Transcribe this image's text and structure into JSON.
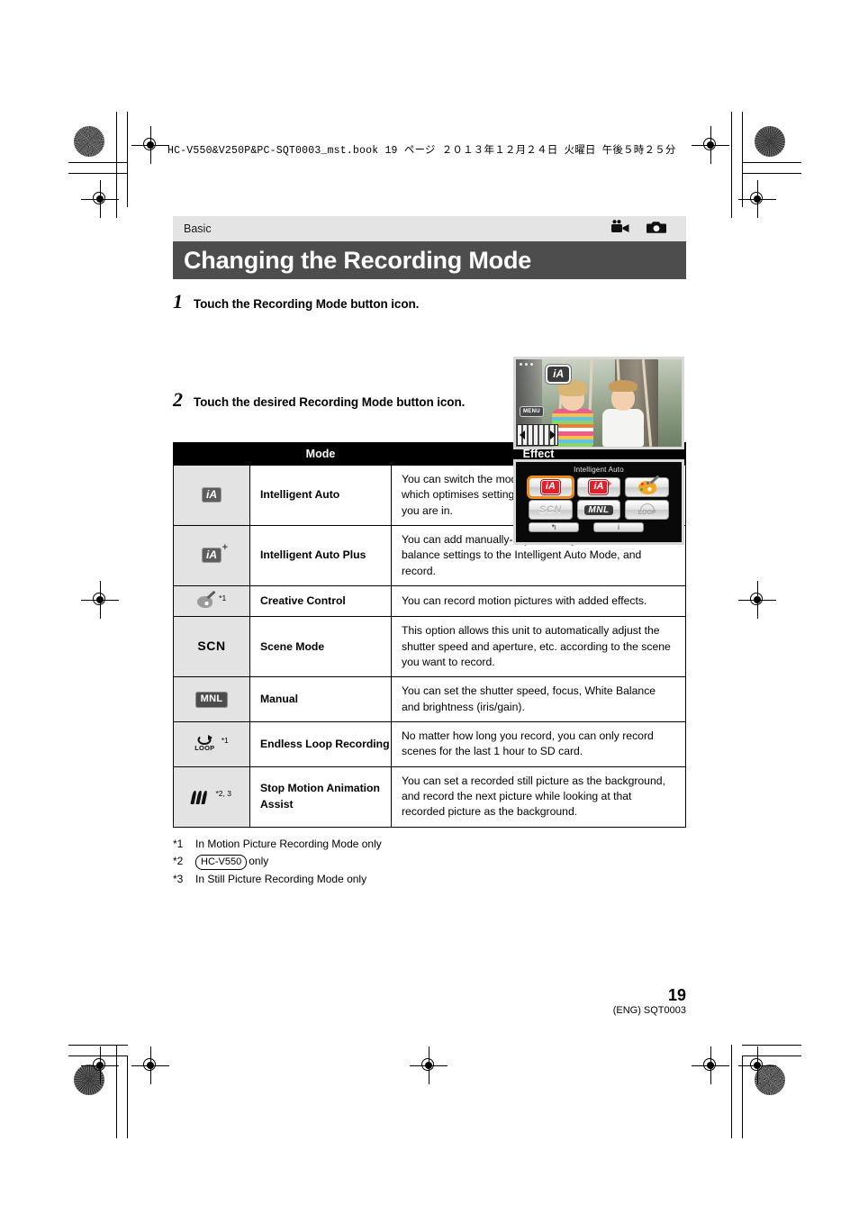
{
  "slug": "HC-V550&V250P&PC-SQT0003_mst.book   19 ページ   ２０１３年１２月２４日   火曜日   午後５時２５分",
  "header": {
    "section_label": "Basic",
    "title": "Changing the Recording Mode",
    "icons": [
      "video-camera-icon",
      "still-camera-icon"
    ]
  },
  "steps": [
    {
      "num": "1",
      "text": "Touch the Recording Mode button icon."
    },
    {
      "num": "2",
      "text": "Touch the desired Recording Mode button icon."
    }
  ],
  "screenshot1": {
    "name": "lcd-preview-screen",
    "badge": "iA",
    "menu_button": "MENU"
  },
  "screenshot2": {
    "name": "recording-mode-menu-screen",
    "title": "Intelligent Auto",
    "buttons": [
      {
        "icon": "ia-icon",
        "label": "iA",
        "selected": true
      },
      {
        "icon": "ia-plus-icon",
        "label": "iA",
        "plus": "+",
        "selected": false
      },
      {
        "icon": "creative-control-palette-icon",
        "label": "",
        "selected": false
      },
      {
        "icon": "scn-icon",
        "label": "SCN",
        "selected": false
      },
      {
        "icon": "mnl-icon",
        "label": "MNL",
        "selected": false
      },
      {
        "icon": "loop-icon",
        "label": "LOOP",
        "selected": false
      }
    ],
    "footer_buttons": [
      {
        "icon": "back-arrow-icon",
        "label": "↰"
      },
      {
        "icon": "info-icon",
        "label": "i"
      }
    ]
  },
  "table": {
    "headers": {
      "mode": "Mode",
      "effect": "Effect"
    },
    "rows": [
      {
        "icon": "ia-icon",
        "icon_text": "iA",
        "footnote": "",
        "name": "Intelligent Auto",
        "effect": "You can switch the mode to the Intelligent Auto Mode, which optimises settings to the recording environment you are in."
      },
      {
        "icon": "ia-plus-icon",
        "icon_text": "iA",
        "footnote": "",
        "name": "Intelligent Auto Plus",
        "effect": "You can add manually-adjusted brightness and color balance settings to the Intelligent Auto Mode, and record."
      },
      {
        "icon": "creative-control-palette-icon",
        "icon_text": "",
        "footnote": "*1",
        "name": "Creative Control",
        "effect": "You can record motion pictures with added effects."
      },
      {
        "icon": "scn-icon",
        "icon_text": "SCN",
        "footnote": "",
        "name": "Scene Mode",
        "effect": "This option allows this unit to automatically adjust the shutter speed and aperture, etc. according to the scene you want to record."
      },
      {
        "icon": "mnl-icon",
        "icon_text": "MNL",
        "footnote": "",
        "name": "Manual",
        "effect": "You can set the shutter speed, focus, White Balance and brightness (iris/gain)."
      },
      {
        "icon": "loop-icon",
        "icon_text": "LOOP",
        "footnote": "*1",
        "name": "Endless Loop Recording",
        "effect": "No matter how long you record, you can only record scenes for the last 1 hour to SD card."
      },
      {
        "icon": "stop-motion-icon",
        "icon_text": "",
        "footnote": "*2, 3",
        "name": "Stop Motion Animation Assist",
        "effect": "You can set a recorded still picture as the background, and record the next picture while looking at that recorded picture as the background."
      }
    ]
  },
  "footnotes": [
    {
      "key": "*1",
      "text": "In Motion Picture Recording Mode only",
      "boxed": ""
    },
    {
      "key": "*2",
      "text": "only",
      "boxed": "HC-V550"
    },
    {
      "key": "*3",
      "text": "In Still Picture Recording Mode only",
      "boxed": ""
    }
  ],
  "footer": {
    "page_number": "19",
    "code": "(ENG) SQT0003"
  }
}
